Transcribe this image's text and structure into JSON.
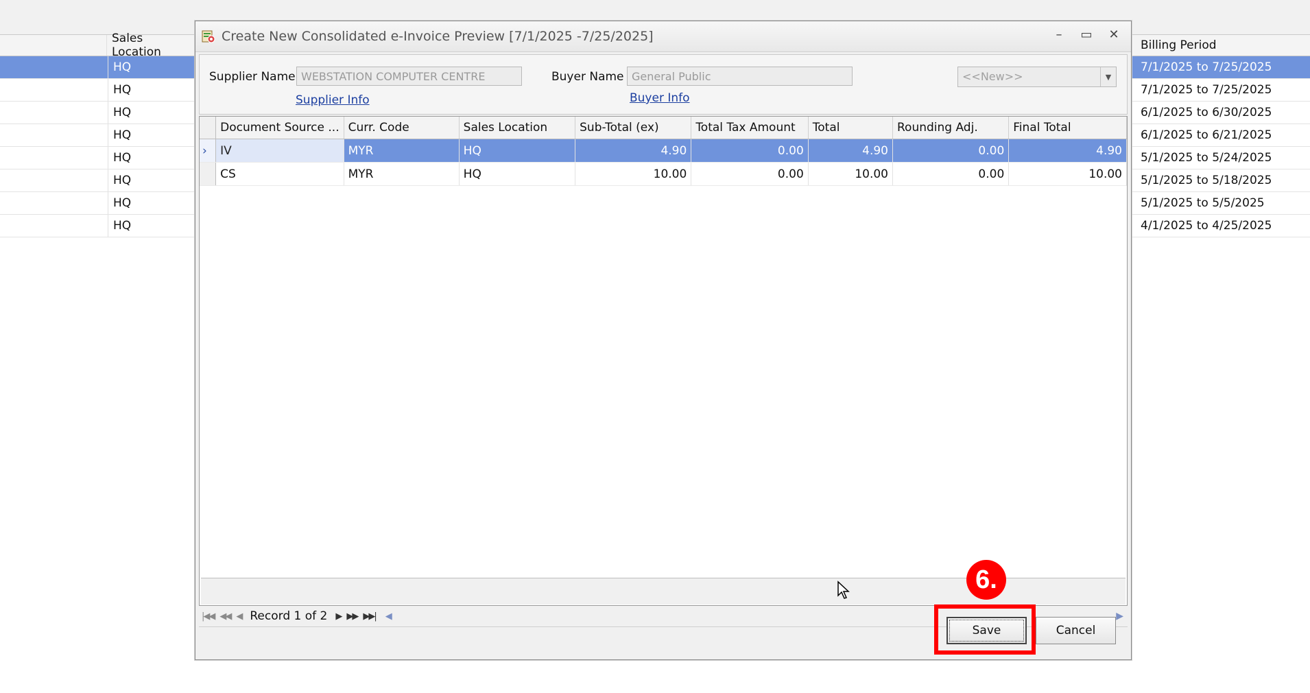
{
  "background": {
    "left_grid": {
      "header": "Sales Location",
      "rows": [
        "HQ",
        "HQ",
        "HQ",
        "HQ",
        "HQ",
        "HQ",
        "HQ",
        "HQ"
      ],
      "selected_index": 0
    },
    "right_grid": {
      "header": "Billing Period",
      "rows": [
        "7/1/2025 to 7/25/2025",
        "7/1/2025 to 7/25/2025",
        "6/1/2025 to 6/30/2025",
        "6/1/2025 to 6/21/2025",
        "5/1/2025 to 5/24/2025",
        "5/1/2025 to 5/18/2025",
        "5/1/2025 to 5/5/2025",
        "4/1/2025 to 4/25/2025"
      ],
      "selected_index": 0
    }
  },
  "dialog": {
    "title": "Create New Consolidated e-Invoice Preview [7/1/2025 -7/25/2025]",
    "window_buttons": {
      "minimize": "–",
      "maximize": "▭",
      "close": "✕"
    },
    "supplier": {
      "label": "Supplier Name",
      "value": "WEBSTATION COMPUTER CENTRE",
      "info_link": "Supplier Info"
    },
    "buyer": {
      "label": "Buyer Name",
      "value": "General Public",
      "info_link": "Buyer Info"
    },
    "combo": {
      "value": "<<New>>"
    },
    "grid": {
      "columns": [
        "Document Source ...",
        "Curr. Code",
        "Sales Location",
        "Sub-Total (ex)",
        "Total Tax Amount",
        "Total",
        "Rounding Adj.",
        "Final Total"
      ],
      "rows": [
        {
          "doc": "IV",
          "curr": "MYR",
          "loc": "HQ",
          "subtotal": "4.90",
          "tax": "0.00",
          "total": "4.90",
          "rounding": "0.00",
          "final": "4.90"
        },
        {
          "doc": "CS",
          "curr": "MYR",
          "loc": "HQ",
          "subtotal": "10.00",
          "tax": "0.00",
          "total": "10.00",
          "rounding": "0.00",
          "final": "10.00"
        }
      ],
      "selected_row": 0
    },
    "navigator": {
      "record_text": "Record 1 of 2"
    },
    "buttons": {
      "save": "Save",
      "cancel": "Cancel"
    }
  },
  "annotation": {
    "step_label": "6.",
    "color": "#ff0000"
  }
}
